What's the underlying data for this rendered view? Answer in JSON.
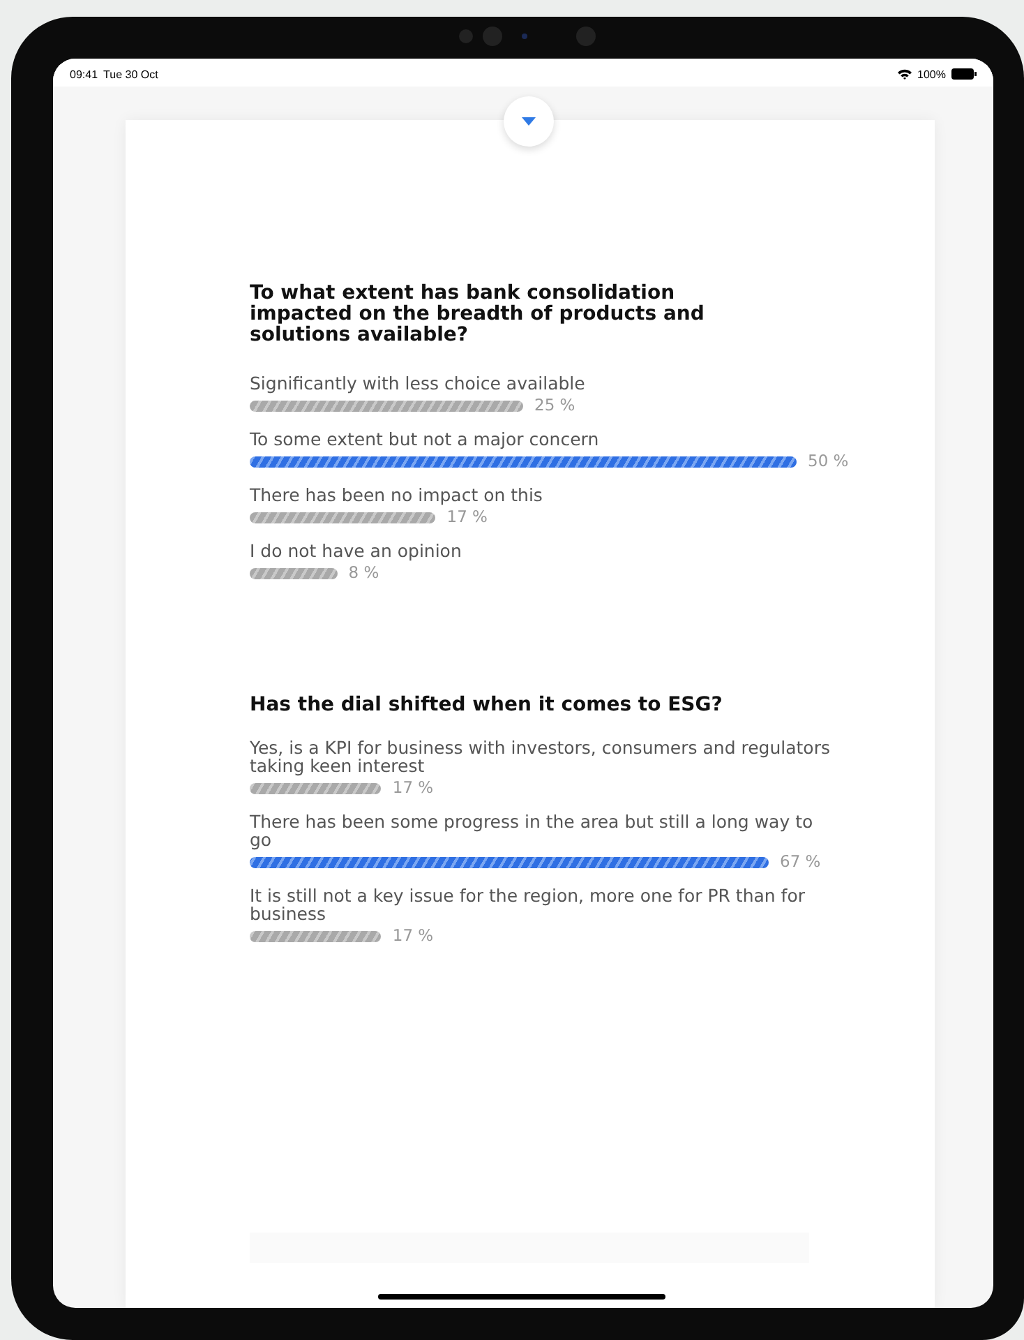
{
  "status_bar": {
    "time": "09:41",
    "date": "Tue 30 Oct",
    "battery": "100%"
  },
  "questions": [
    {
      "title": "To what extent has bank consolidation impacted on the breadth of products and solutions available?",
      "options": [
        {
          "label": "Significantly with less choice available",
          "percent": "25 %",
          "selected": false
        },
        {
          "label": "To some extent but not a major concern",
          "percent": "50 %",
          "selected": true
        },
        {
          "label": "There has been no impact on this",
          "percent": "17 %",
          "selected": false
        },
        {
          "label": "I do not have an opinion",
          "percent": "8 %",
          "selected": false
        }
      ]
    },
    {
      "title": "Has the dial shifted when it comes to ESG?",
      "options": [
        {
          "label": "Yes, is a KPI for business with investors, consumers and regulators taking keen interest",
          "percent": "17 %",
          "selected": false
        },
        {
          "label": "There has been some progress in the area but still a long way to go",
          "percent": "67 %",
          "selected": true
        },
        {
          "label": "It is still not a key issue for the region, more one for PR than for business",
          "percent": "17 %",
          "selected": false
        }
      ]
    }
  ]
}
